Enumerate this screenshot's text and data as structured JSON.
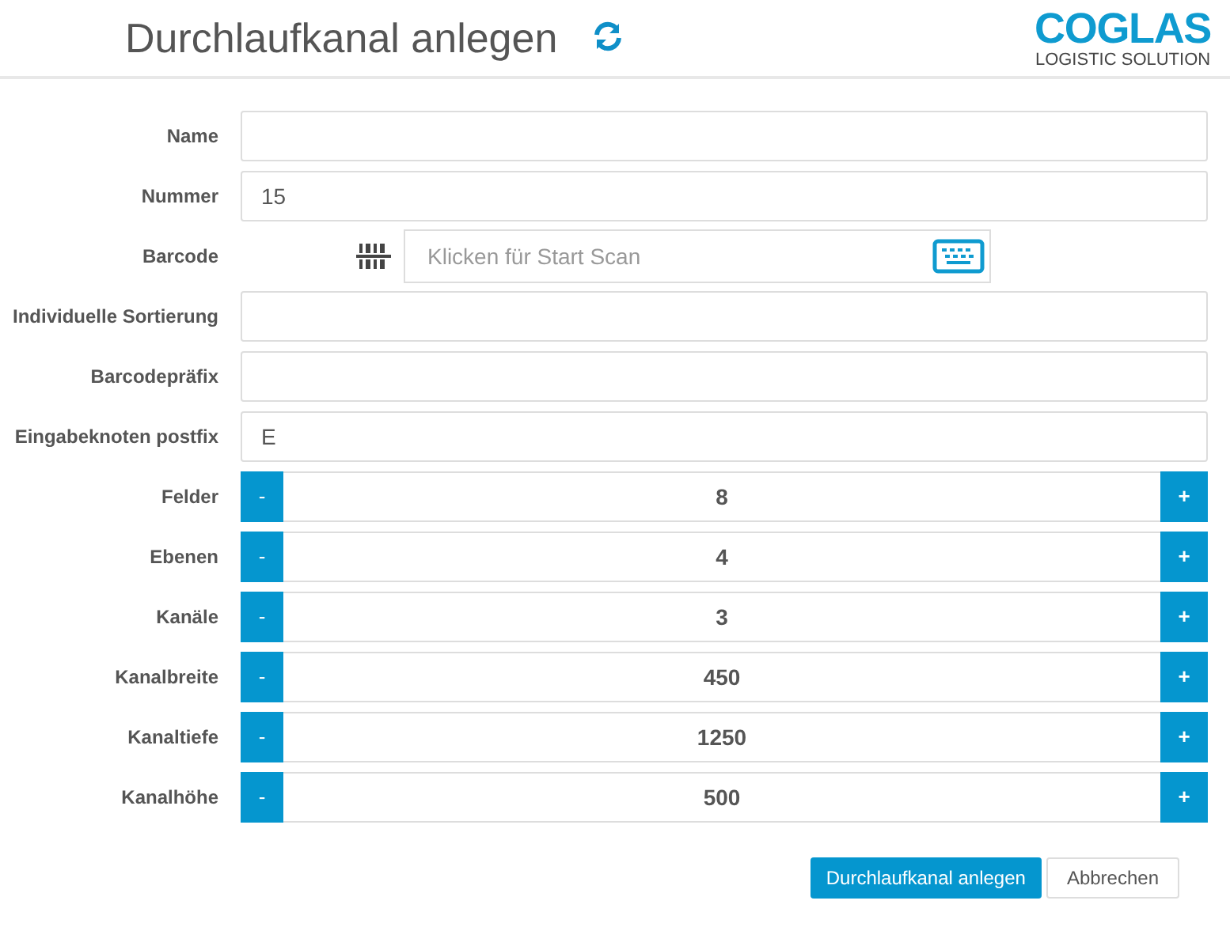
{
  "header": {
    "title": "Durchlaufkanal anlegen",
    "logo": {
      "name": "COGLAS",
      "tagline": "LOGISTIC SOLUTION"
    }
  },
  "fields": [
    {
      "kind": "text",
      "label": "Name"
    },
    {
      "kind": "text",
      "label": "Nummer",
      "value": "15"
    },
    {
      "kind": "barcode",
      "label": "Barcode",
      "placeholder": "Klicken für Start Scan"
    },
    {
      "kind": "text",
      "label": "Individuelle Sortierung"
    },
    {
      "kind": "text",
      "label": "Barcodepräfix"
    },
    {
      "kind": "text",
      "label": "Eingabeknoten postfix",
      "value": "E"
    },
    {
      "kind": "stepper",
      "label": "Felder",
      "value": "8",
      "minus": "-",
      "plus": "+"
    },
    {
      "kind": "stepper",
      "label": "Ebenen",
      "value": "4",
      "minus": "-",
      "plus": "+"
    },
    {
      "kind": "stepper",
      "label": "Kanäle",
      "value": "3",
      "minus": "-",
      "plus": "+"
    },
    {
      "kind": "stepper",
      "label": "Kanalbreite",
      "value": "450",
      "minus": "-",
      "plus": "+"
    },
    {
      "kind": "stepper",
      "label": "Kanaltiefe",
      "value": "1250",
      "minus": "-",
      "plus": "+"
    },
    {
      "kind": "stepper",
      "label": "Kanalhöhe",
      "value": "500",
      "minus": "-",
      "plus": "+"
    }
  ],
  "buttons": [
    {
      "label": "Durchlaufkanal anlegen",
      "kind": "primary"
    },
    {
      "label": "Abbrechen",
      "kind": "default"
    }
  ]
}
